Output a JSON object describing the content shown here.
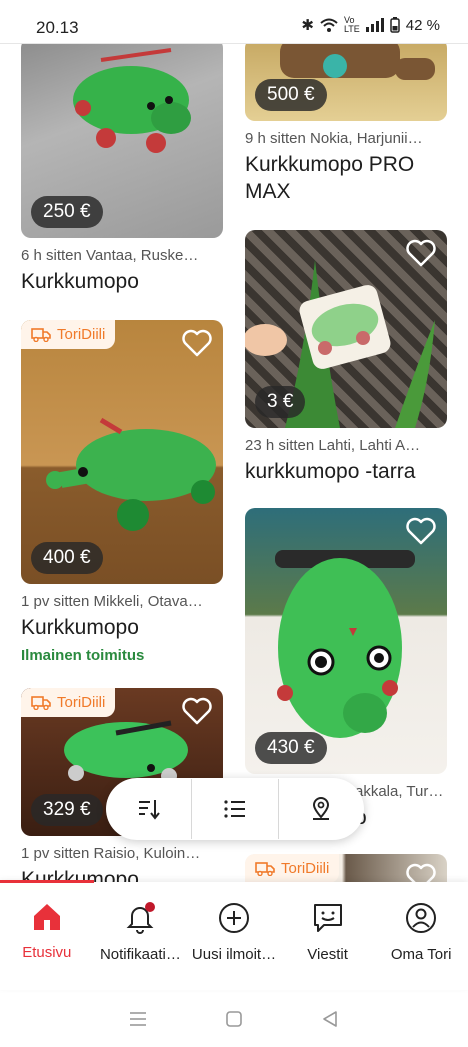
{
  "status_bar": {
    "time": "20.13",
    "battery": "42 %"
  },
  "listings": [
    {
      "price": "250 €",
      "meta": "6 h sitten   Vantaa, Ruske…",
      "title": "Kurkkumopo"
    },
    {
      "price": "500 €",
      "meta": "9 h sitten   Nokia, Harjunii…",
      "title": "Kurkkumopo PRO MAX"
    },
    {
      "price": "3 €",
      "meta": "23 h sitten   Lahti, Lahti A…",
      "title": "kurkkumopo -tarra"
    },
    {
      "badge": "ToriDiili",
      "price": "400 €",
      "meta": "1 pv sitten   Mikkeli, Otava…",
      "title": "Kurkkumopo",
      "shipping": "Ilmainen toimitus"
    },
    {
      "price": "430 €",
      "meta": "akkala, Tur…",
      "title": "o"
    },
    {
      "badge": "ToriDiili",
      "price": "329 €",
      "meta": "1 pv sitten   Raisio, Kuloin…",
      "title": "Kurkkumopo"
    },
    {
      "badge": "ToriDiili"
    }
  ],
  "floating_bar": {
    "items": [
      "sort-icon",
      "list-view-icon",
      "location-icon"
    ]
  },
  "bottom_nav": [
    {
      "label": "Etusivu",
      "icon": "home-icon",
      "active": true
    },
    {
      "label": "Notifikaati…",
      "icon": "bell-icon"
    },
    {
      "label": "Uusi ilmoit…",
      "icon": "plus-circle-icon"
    },
    {
      "label": "Viestit",
      "icon": "chat-icon"
    },
    {
      "label": "Oma Tori",
      "icon": "profile-icon"
    }
  ],
  "colors": {
    "accent": "#e8313a",
    "deal_orange": "#f07a2a",
    "shipping_green": "#2a8a3e"
  }
}
